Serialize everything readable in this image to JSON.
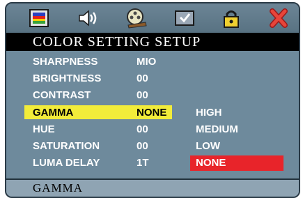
{
  "toolbar": {
    "icons": [
      "picture-icon",
      "speaker-icon",
      "film-reel-icon",
      "checkmark-screen-icon",
      "padlock-icon",
      "exit-x-icon"
    ]
  },
  "title": "COLOR SETTING SETUP",
  "settings": [
    {
      "label": "SHARPNESS",
      "value": "MIO"
    },
    {
      "label": "BRIGHTNESS",
      "value": "00"
    },
    {
      "label": "CONTRAST",
      "value": "00"
    },
    {
      "label": "GAMMA",
      "value": "NONE",
      "active": true
    },
    {
      "label": "HUE",
      "value": "00"
    },
    {
      "label": "SATURATION",
      "value": "00"
    },
    {
      "label": "LUMA DELAY",
      "value": "1T"
    }
  ],
  "gamma_options": [
    {
      "label": "HIGH"
    },
    {
      "label": "MEDIUM"
    },
    {
      "label": "LOW"
    },
    {
      "label": "NONE",
      "selected": true
    }
  ],
  "footer": {
    "description": "GAMMA"
  },
  "colors": {
    "highlight": "#f2ec3a",
    "selection": "#e8242a",
    "panel": "#6e8a9c",
    "title_bar": "#000000"
  }
}
